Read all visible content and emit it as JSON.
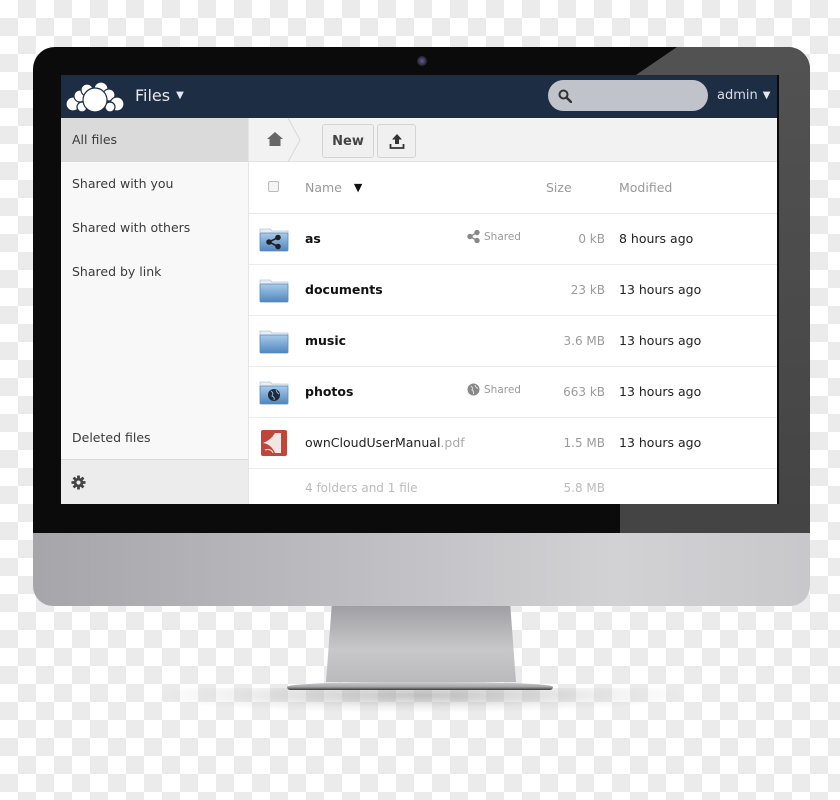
{
  "app": {
    "name": "Files",
    "user": "admin",
    "search_placeholder": ""
  },
  "colors": {
    "topbar": "#1d2d44",
    "sidebar_bg": "#f8f8f8",
    "active_nav": "#dadada",
    "folder_blue": "#6fa4d4",
    "pdf_red": "#c0463a"
  },
  "icons": {
    "logo": "owncloud-cloud-logo",
    "search": "magnifier-icon",
    "home": "home-icon",
    "upload": "upload-icon",
    "settings": "gear-icon",
    "shared_link": "share-icon",
    "shared_public": "globe-icon",
    "folder": "folder-icon",
    "pdf": "pdf-icon",
    "sort": "triangle-down"
  },
  "sidebar": {
    "items": [
      {
        "label": "All files",
        "active": true
      },
      {
        "label": "Shared with you",
        "active": false
      },
      {
        "label": "Shared with others",
        "active": false
      },
      {
        "label": "Shared by link",
        "active": false
      }
    ],
    "deleted": "Deleted files"
  },
  "toolbar": {
    "new_label": "New"
  },
  "table": {
    "headers": {
      "name": "Name",
      "size": "Size",
      "modified": "Modified"
    },
    "sort_indicator": "▼",
    "rows": [
      {
        "name": "as",
        "ext": "",
        "type": "folder-shared",
        "share": "Shared",
        "share_icon": "share",
        "size": "0 kB",
        "modified": "8 hours ago"
      },
      {
        "name": "documents",
        "ext": "",
        "type": "folder",
        "share": "",
        "share_icon": "",
        "size": "23 kB",
        "modified": "13 hours ago"
      },
      {
        "name": "music",
        "ext": "",
        "type": "folder",
        "share": "",
        "share_icon": "",
        "size": "3.6 MB",
        "modified": "13 hours ago"
      },
      {
        "name": "photos",
        "ext": "",
        "type": "folder-public",
        "share": "Shared",
        "share_icon": "globe",
        "size": "663 kB",
        "modified": "13 hours ago"
      },
      {
        "name": "ownCloudUserManual",
        "ext": ".pdf",
        "type": "pdf",
        "share": "",
        "share_icon": "",
        "size": "1.5 MB",
        "modified": "13 hours ago"
      }
    ],
    "summary": {
      "count": "4 folders and 1 file",
      "total": "5.8 MB"
    }
  }
}
